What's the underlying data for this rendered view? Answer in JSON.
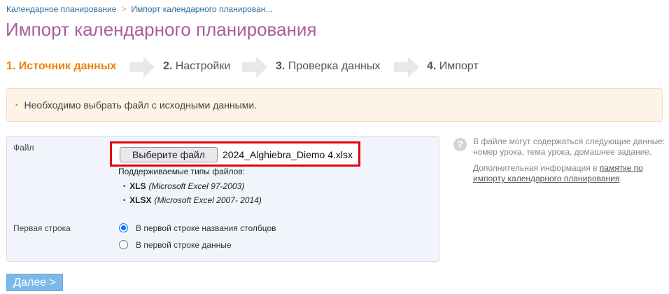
{
  "breadcrumb": {
    "items": [
      "Календарное планирование",
      "Импорт календарного планирован..."
    ],
    "separator": ">"
  },
  "page": {
    "title": "Импорт календарного планирования"
  },
  "steps": [
    {
      "number": "1.",
      "label": "Источник данных",
      "active": true
    },
    {
      "number": "2.",
      "label": "Настройки",
      "active": false
    },
    {
      "number": "3.",
      "label": "Проверка данных",
      "active": false
    },
    {
      "number": "4.",
      "label": "Импорт",
      "active": false
    }
  ],
  "alert": {
    "bullet": "•",
    "message": "Необходимо выбрать файл с исходными данными."
  },
  "form": {
    "file_label": "Файл",
    "file_button_label": "Выберите файл",
    "file_name": "2024_Alghiebra_Diemo 4.xlsx",
    "types_title": "Поддерживаемые типы файлов:",
    "types": [
      {
        "bullet": "•",
        "ext": "XLS",
        "desc": "(Microsoft Excel 97-2003)"
      },
      {
        "bullet": "•",
        "ext": "XLSX",
        "desc": "(Microsoft Excel 2007- 2014)"
      }
    ],
    "first_row_label": "Первая строка",
    "first_row_options": [
      {
        "label": "В первой строке названия столбцов",
        "checked": true
      },
      {
        "label": "В первой строке данные",
        "checked": false
      }
    ]
  },
  "help": {
    "icon": "?",
    "text1": "В файле могут содержаться следующие данные: номер урока, тема урока, домашнее задание.",
    "text2_prefix": "Дополнительная информация в ",
    "link": "памятке по импорту календарного планирования",
    "text2_suffix": "."
  },
  "next_button_label": "Далее >",
  "colors": {
    "title": "#a75e9c",
    "active_step": "#e8820c",
    "link": "#2f6f9e",
    "highlight_border": "#e3000f",
    "next_button": "#7cb8e8",
    "alert_background": "#fdf3e7",
    "panel_background": "#f1f4fa"
  }
}
